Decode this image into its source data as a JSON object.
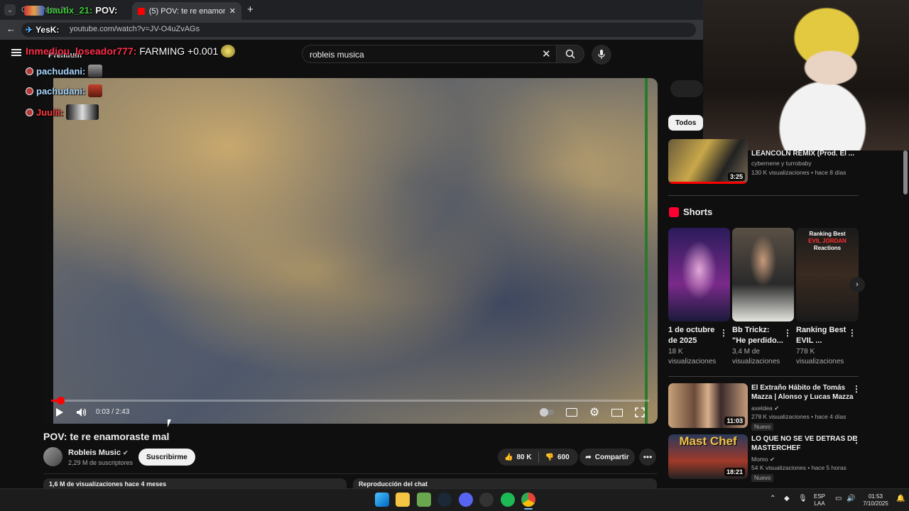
{
  "browser": {
    "tab_inactive_label": "Co... Pagu 21",
    "tab_active_label": "(5) POV: te re enamoraste mal",
    "new_tab_icon": "plus-icon",
    "url": "youtube.com/watch?v=JV-O4uZvAGs"
  },
  "youtube": {
    "logo_label": "Premium",
    "search_query": "robleis musica",
    "video": {
      "title": "POV: te re enamoraste mal",
      "time": "0:03 / 2:43",
      "progress_fraction": 0.012,
      "channel": "Robleis Music",
      "subscribers": "2,29 M de suscriptores",
      "subscribe_label": "Suscribirme",
      "likes": "80 K",
      "dislikes": "600",
      "share_label": "Compartir",
      "description_preview": "1,6 M de visualizaciones  hace 4 meses",
      "chat_replay_label": "Reproducción del chat"
    },
    "sidebar": {
      "chip_all": "Todos",
      "top_video": {
        "title": "LEANCOLN REMIX (Prod. El ...",
        "channel": "cybernene y turrobaby",
        "meta": "130 K visualizaciones • hace 8 días",
        "duration": "3:25"
      },
      "shorts_heading": "Shorts",
      "shorts": [
        {
          "title_line1": "1 de octubre",
          "title_line2": "de 2025",
          "views_line1": "18 K",
          "views_line2": "visualizaciones"
        },
        {
          "title_line1": "Bb Trickz:",
          "title_line2": "\"He perdido...",
          "views_line1": "3,4 M de",
          "views_line2": "visualizaciones"
        },
        {
          "title_line1": "Ranking Best",
          "title_line2": "EVIL ...",
          "views_line1": "778 K",
          "views_line2": "visualizaciones",
          "thumb_caption_1": "Ranking Best",
          "thumb_caption_2": "EVIL JORDAN",
          "thumb_caption_3": "Reactions"
        }
      ],
      "videos": [
        {
          "title_line1": "El Extraño Hábito de Tomás",
          "title_line2": "Mazza | Alonso y Lucas Mazza",
          "channel": "axeldea",
          "meta": "278 K visualizaciones • hace 4 días",
          "badge": "Nuevo",
          "duration": "11:03"
        },
        {
          "title_line1": "LO QUE NO SE VE DETRAS DE",
          "title_line2": "MASTERCHEF",
          "channel": "Momo",
          "meta": "54 K visualizaciones • hace 5 horas",
          "badge": "Nuevo",
          "duration": "18:21",
          "thumb_caption": "Mast Chef"
        }
      ]
    }
  },
  "stream_overlay": {
    "chat": [
      {
        "user": "bautix_21:",
        "message": "POV:"
      },
      {
        "user": "YesK:",
        "message": ""
      },
      {
        "user": "Inmediou_loseador777:",
        "message": "FARMING +0.001"
      },
      {
        "user": "pachudani:",
        "message": ""
      },
      {
        "user": "pachudani:",
        "message": ""
      },
      {
        "user": "Juulii:",
        "message": ""
      }
    ]
  },
  "taskbar": {
    "language": "ESP",
    "layout": "LAA",
    "time": "01:53",
    "date": "7/10/2025"
  },
  "colors": {
    "accent": "#ff0000",
    "background": "#0f0f0f",
    "chip": "#272727"
  }
}
